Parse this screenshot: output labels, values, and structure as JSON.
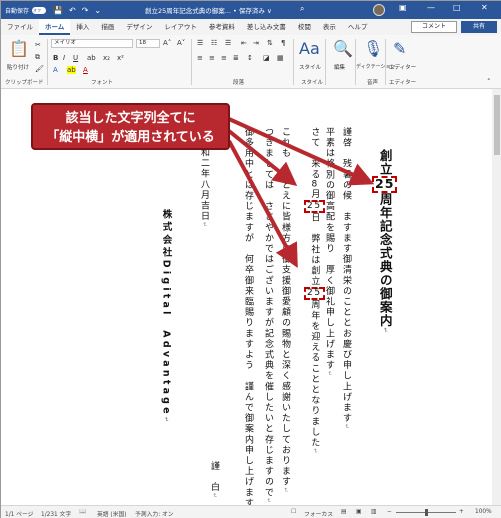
{
  "titlebar": {
    "autosave_label": "自動保存",
    "autosave_state": "オフ",
    "document_title": "創立25周年記念式典の御案... • 保存済み ∨",
    "search_icon": "search-icon",
    "minimize": "—",
    "maximize": "□",
    "close": "✕"
  },
  "tabs": [
    "ファイル",
    "ホーム",
    "挿入",
    "描画",
    "デザイン",
    "レイアウト",
    "参考資料",
    "差し込み文書",
    "校閲",
    "表示",
    "ヘルプ"
  ],
  "active_tab": "ホーム",
  "header_buttons": {
    "comment": "コメント",
    "share": "共有"
  },
  "ribbon": {
    "paste_label": "貼り付け",
    "font_name": "メイリオ",
    "font_size": "18",
    "font_group": "フォント",
    "clipboard_group": "クリップボード",
    "paragraph_group": "段落",
    "style_label": "スタイル",
    "style_group": "スタイル",
    "edit_label": "編集",
    "dictation_label": "ディクテーション",
    "voice_group": "音声",
    "editor_label": "エディター",
    "editor_group": "エディター",
    "bold": "B",
    "italic": "I",
    "underline": "U",
    "font_color_glyph": "A"
  },
  "document": {
    "title_pre": "創立",
    "title_num": "25",
    "title_post": "周年記念式典の御案内",
    "line1": "謹啓　残暑の候　ますます御清栄のこととお慶び申し上げます",
    "line2": "平素は格別の御高配を賜り　厚く御礼申し上げます",
    "line3_pre": "さて　来る",
    "line3_num1": "8",
    "line3_mid": "月",
    "line3_num2": "25",
    "line3_mid2": "日　弊社は創立",
    "line3_num3": "25",
    "line3_post": "周年を迎えることとなりました",
    "line4": "これも　ひとえに皆様方の御支援御愛顧の賜物と深く感謝いたしております",
    "line5": "つきましては　ささやかではございますが記念式典を催したいと存じますので",
    "line6": "御多用中とは存じますが　何卒御来臨賜りますよう　謹んで御案内申し上げます",
    "date_line": "令和二年八月吉日",
    "company": "株式会社Digital　Advantage",
    "closing": "謹　白",
    "paragraph_mark": "↵"
  },
  "callout": {
    "line1": "該当した文字列全てに",
    "line2": "「縦中横」が適用されている"
  },
  "statusbar": {
    "page": "1/1 ページ",
    "words": "1/231 文字",
    "language": "英語 (米国)",
    "predict": "予測入力: オン",
    "focus": "フォーカス",
    "zoom": "100%"
  }
}
